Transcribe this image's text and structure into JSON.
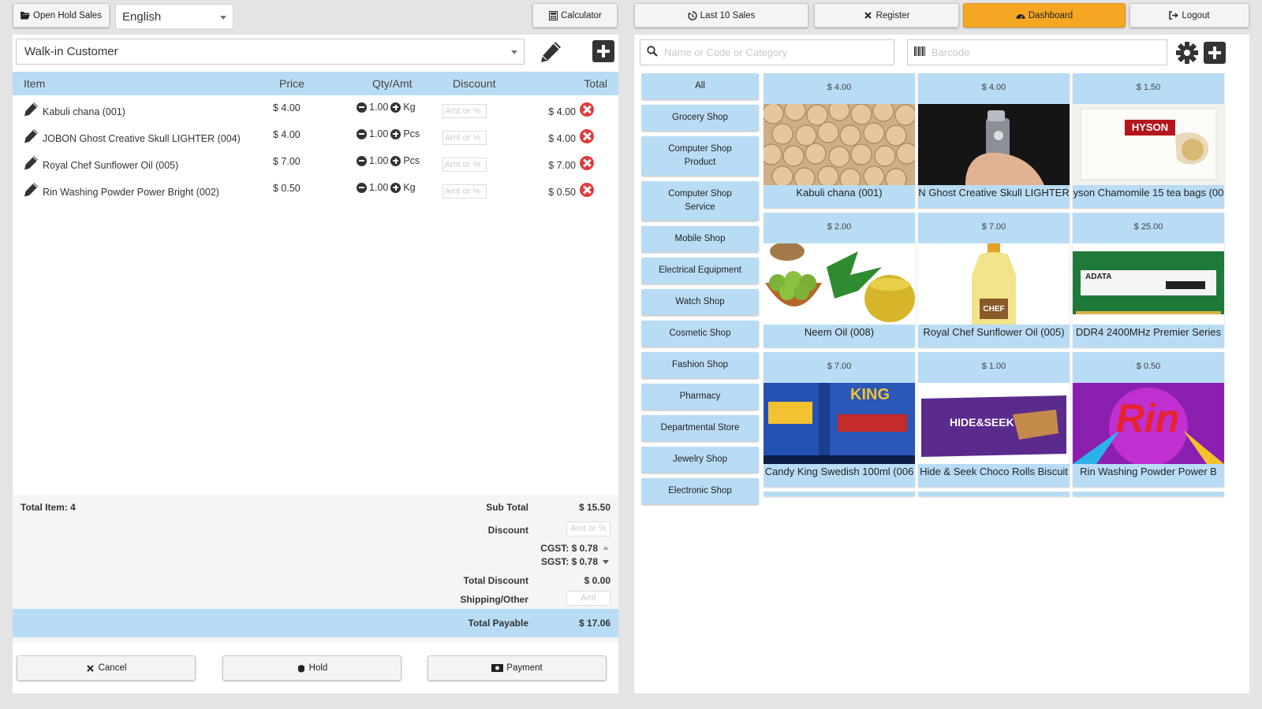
{
  "topbar": {
    "open_hold_sales": "Open Hold Sales",
    "language": "English",
    "calculator": "Calculator",
    "last_10_sales": "Last 10 Sales",
    "register": "Register",
    "dashboard": "Dashboard",
    "logout": "Logout"
  },
  "customer": {
    "selected": "Walk-in Customer"
  },
  "cart": {
    "headers": {
      "item": "Item",
      "price": "Price",
      "qty": "Qty/Amt",
      "discount": "Discount",
      "total": "Total"
    },
    "discount_placeholder": "Amt or %",
    "items": [
      {
        "name": "Kabuli chana (001)",
        "price": "$ 4.00",
        "qty": "1.00",
        "unit": "Kg",
        "total": "$ 4.00"
      },
      {
        "name": "JOBON Ghost Creative Skull LIGHTER (004)",
        "price": "$ 4.00",
        "qty": "1.00",
        "unit": "Pcs",
        "total": "$ 4.00"
      },
      {
        "name": "Royal Chef Sunflower Oil (005)",
        "price": "$ 7.00",
        "qty": "1.00",
        "unit": "Pcs",
        "total": "$ 7.00"
      },
      {
        "name": "Rin Washing Powder Power Bright (002)",
        "price": "$ 0.50",
        "qty": "1.00",
        "unit": "Kg",
        "total": "$ 0.50"
      }
    ]
  },
  "summary": {
    "total_item": "Total Item: 4",
    "subtotal_label": "Sub Total",
    "subtotal": "$ 15.50",
    "discount_label": "Discount",
    "discount_placeholder": "Amt or %",
    "cgst": "CGST: $ 0.78",
    "sgst": "SGST: $ 0.78",
    "total_discount_label": "Total Discount",
    "total_discount": "$ 0.00",
    "shipping_label": "Shipping/Other",
    "shipping_placeholder": "Amt",
    "total_payable_label": "Total Payable",
    "total_payable": "$ 17.06"
  },
  "actions": {
    "cancel": "Cancel",
    "hold": "Hold",
    "payment": "Payment"
  },
  "search": {
    "name_placeholder": "Name or Code or Category",
    "barcode_placeholder": "Barcode"
  },
  "categories": [
    "All",
    "Grocery Shop",
    "Computer Shop Product",
    "Computer Shop Service",
    "Mobile Shop",
    "Electrical Equipment",
    "Watch Shop",
    "Cosmetic Shop",
    "Fashion Shop",
    "Pharmacy",
    "Departmental Store",
    "Jewelry Shop",
    "Electronic Shop"
  ],
  "products": [
    {
      "price": "$ 4.00",
      "name": "Kabuli chana (001)",
      "image": "chickpeas"
    },
    {
      "price": "$ 4.00",
      "name": "N Ghost Creative Skull LIGHTER",
      "image": "lighter"
    },
    {
      "price": "$ 1.50",
      "name": "yson Chamomile 15 tea bags (00",
      "image": "tea",
      "logo_text": "HYSON"
    },
    {
      "price": "$ 2.00",
      "name": "Neem Oil (008)",
      "image": "neem"
    },
    {
      "price": "$ 7.00",
      "name": "Royal Chef Sunflower Oil (005)",
      "image": "oil",
      "logo_text": "CHEF"
    },
    {
      "price": "$ 25.00",
      "name": "DDR4 2400MHz Premier Series",
      "image": "ram",
      "logo_text": "ADATA"
    },
    {
      "price": "$ 7.00",
      "name": "Candy King Swedish 100ml (006",
      "image": "candyking",
      "logo_text": "KING"
    },
    {
      "price": "$ 1.00",
      "name": "Hide & Seek Choco Rolls Biscuit",
      "image": "biscuit",
      "logo_text": "HIDE&SEEK"
    },
    {
      "price": "$ 0.50",
      "name": "Rin Washing Powder Power B",
      "image": "rin",
      "logo_text": "Rin"
    }
  ],
  "colors": {
    "accent_blue": "#b9dcf5",
    "dashboard_orange": "#f5a623",
    "remove_red": "#e23a3a"
  }
}
